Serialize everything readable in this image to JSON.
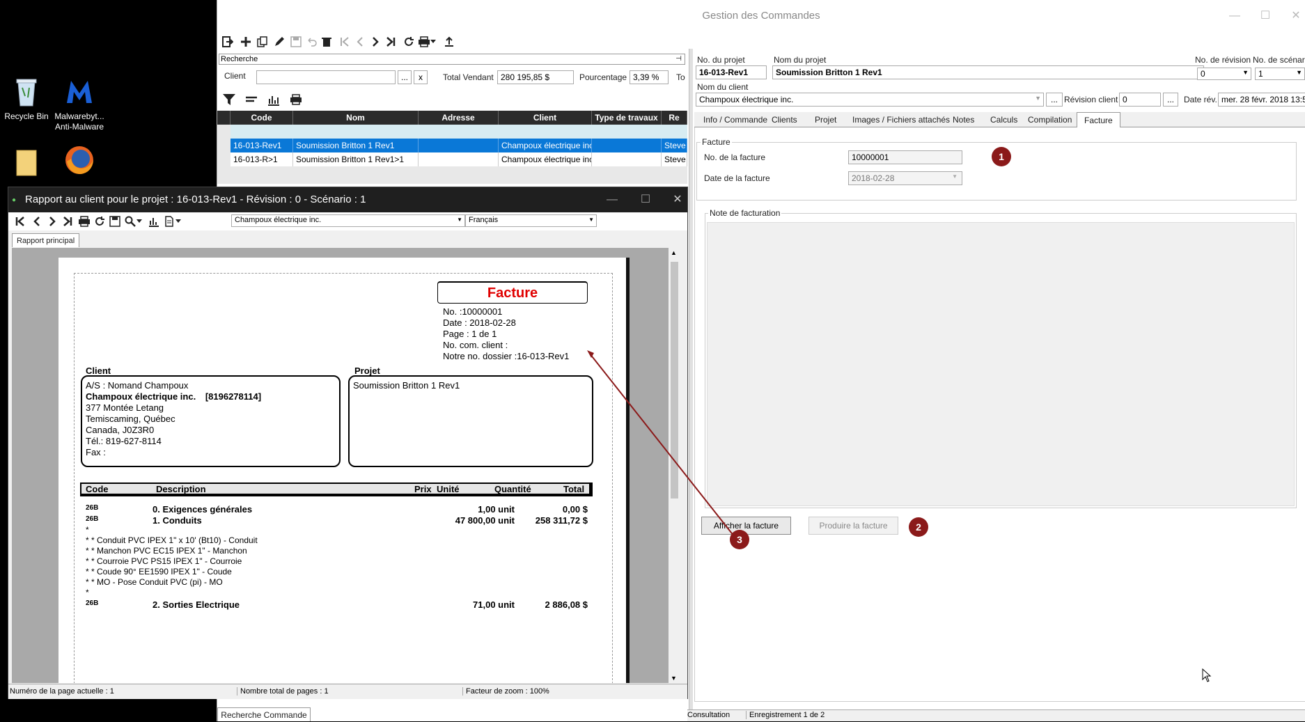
{
  "desktop": {
    "icons": [
      {
        "label": "Recycle Bin"
      },
      {
        "label": "Malwarebyt... Anti-Malware"
      }
    ]
  },
  "main_window": {
    "title": "Gestion des Commandes",
    "search_header": "Recherche",
    "filter": {
      "client_label": "Client",
      "client_value": "",
      "browse_btn": "...",
      "clear_btn": "x",
      "total_label": "Total Vendant",
      "total_value": "280 195,85 $",
      "percent_label": "Pourcentage",
      "percent_value": "3,39 %",
      "extra_label": "To"
    },
    "grid": {
      "columns": [
        "Code",
        "Nom",
        "Adresse",
        "Client",
        "Type de travaux",
        "Re"
      ],
      "rows": [
        {
          "code": "16-013-Rev1",
          "nom": "Soumission Britton 1 Rev1",
          "adresse": "",
          "client": "Champoux électrique inc.",
          "type": "",
          "re": "Steve"
        },
        {
          "code": "16-013-R>1",
          "nom": "Soumission Britton 1 Rev1>1",
          "adresse": "",
          "client": "Champoux électrique inc.",
          "type": "",
          "re": "Steve"
        }
      ]
    },
    "bottom_tab": "Recherche Commande",
    "status": {
      "mode": "Consultation",
      "record": "Enregistrement 1 de 2"
    }
  },
  "project_form": {
    "no_projet_label": "No. du projet",
    "no_projet_value": "16-013-Rev1",
    "nom_projet_label": "Nom du projet",
    "nom_projet_value": "Soumission Britton 1 Rev1",
    "no_revision_label": "No. de révision",
    "no_revision_value": "0",
    "no_scenario_label": "No. de scénario",
    "no_scenario_value": "1",
    "nom_client_label": "Nom du client",
    "nom_client_value": "Champoux électrique inc.",
    "browse_btn": "...",
    "revision_client_label": "Révision client",
    "revision_client_value": "0",
    "date_rev_label": "Date rév.",
    "date_rev_value": "mer. 28 févr. 2018 13:5:",
    "tabs": [
      "Info / Commande",
      "Clients",
      "Projet",
      "Images / Fichiers attachés",
      "Notes",
      "Calculs",
      "Compilation",
      "Facture"
    ],
    "facture_group": "Facture",
    "no_facture_label": "No. de la facture",
    "no_facture_value": "10000001",
    "date_facture_label": "Date de la facture",
    "date_facture_value": "2018-02-28",
    "note_group": "Note de facturation",
    "afficher_btn": "Afficher la facture",
    "produire_btn": "Produire la facture",
    "badges": [
      "1",
      "2",
      "3"
    ]
  },
  "report": {
    "title": "Rapport au client pour le projet : 16-013-Rev1 - Révision : 0 - Scénario : 1",
    "client_select": "Champoux électrique inc.",
    "language_select": "Français",
    "tab": "Rapport principal",
    "invoice_title": "Facture",
    "header_lines": [
      "No. :10000001",
      "Date : 2018-02-28",
      "Page : 1 de 1",
      "No. com. client :",
      "Notre no. dossier :16-013-Rev1"
    ],
    "client_label": "Client",
    "projet_label": "Projet",
    "client_lines": [
      "A/S : Nomand Champoux",
      "377 Montée Letang",
      "Temiscaming, Québec",
      "Canada, J0Z3R0",
      "Tél.:  819-627-8114",
      "Fax :"
    ],
    "client_company": "Champoux électrique inc.",
    "client_phone_code": "[8196278114]",
    "projet_text": "Soumission Britton 1 Rev1",
    "table_headers": {
      "code": "Code",
      "description": "Description",
      "prix": "Prix",
      "unite": "Unité",
      "quantite": "Quantité",
      "total": "Total"
    },
    "items": [
      {
        "code": "26B",
        "desc": "0. Exigences générales",
        "qty": "1,00 unit",
        "total": "0,00 $"
      },
      {
        "code": "26B",
        "desc": "1. Conduits",
        "qty": "47 800,00 unit",
        "total": "258 311,72 $"
      }
    ],
    "sub_lines": [
      "*",
      "* * Conduit PVC IPEX 1\" x 10' (Bt10) - Conduit",
      "* * Manchon PVC EC15 IPEX 1\" - Manchon",
      "* * Courroie PVC PS15 IPEX 1\" - Courroie",
      "* * Coude 90° EE1590 IPEX 1\" - Coude",
      "* * MO - Pose Conduit PVC (pi) - MO",
      "*"
    ],
    "item3": {
      "code": "26B",
      "desc": "2. Sorties Electrique",
      "qty": "71,00 unit",
      "total": "2 886,08 $"
    },
    "status_page": "Numéro de la page actuelle : 1",
    "status_total": "Nombre total de pages : 1",
    "status_zoom": "Facteur de zoom : 100%"
  },
  "colors": {
    "accent_select": "#0a78d7",
    "badge": "#8b1a1a",
    "invoice_title": "#e00000"
  }
}
